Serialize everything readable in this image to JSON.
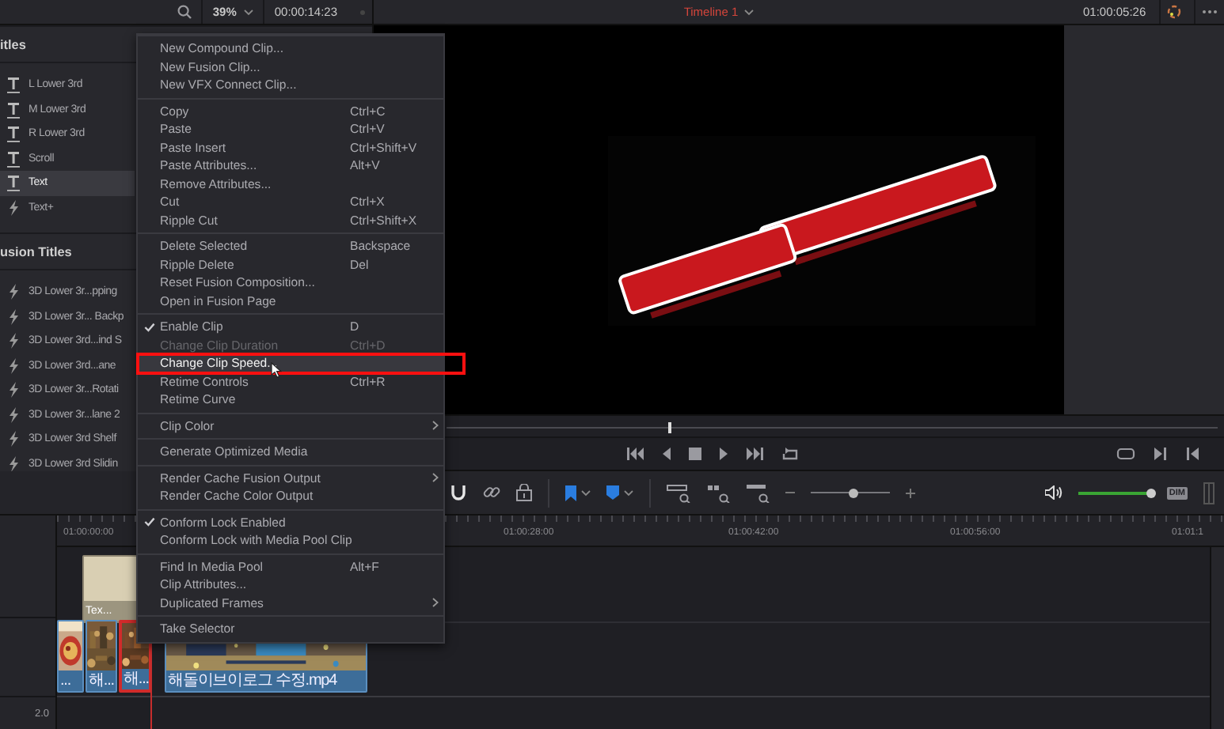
{
  "top_bar": {
    "zoom": "39%",
    "source_timecode": "00:00:14:23",
    "timeline_name": "Timeline 1",
    "record_timecode": "01:00:05:26"
  },
  "title_panel": {
    "sections": [
      {
        "heading": "itles",
        "items": [
          {
            "label": "L Lower 3rd",
            "kind": "text",
            "selected": false
          },
          {
            "label": "M Lower 3rd",
            "kind": "text",
            "selected": false
          },
          {
            "label": "R Lower 3rd",
            "kind": "text",
            "selected": false
          },
          {
            "label": "Scroll",
            "kind": "text",
            "selected": false
          },
          {
            "label": "Text",
            "kind": "text",
            "selected": true
          },
          {
            "label": "Text+",
            "kind": "fusion",
            "selected": false
          }
        ]
      },
      {
        "heading": "usion Titles",
        "items": [
          {
            "label": "3D Lower 3r...pping",
            "kind": "fusion",
            "selected": false
          },
          {
            "label": "3D Lower 3r... Backp",
            "kind": "fusion",
            "selected": false
          },
          {
            "label": "3D Lower 3rd...ind S",
            "kind": "fusion",
            "selected": false
          },
          {
            "label": "3D Lower 3rd...ane",
            "kind": "fusion",
            "selected": false
          },
          {
            "label": "3D Lower 3r...Rotati",
            "kind": "fusion",
            "selected": false
          },
          {
            "label": "3D Lower 3r...lane 2",
            "kind": "fusion",
            "selected": false
          },
          {
            "label": "3D Lower 3rd Shelf",
            "kind": "fusion",
            "selected": false
          },
          {
            "label": "3D Lower 3rd Slidin",
            "kind": "fusion",
            "selected": false
          }
        ]
      }
    ]
  },
  "scrubber": {
    "level": 0.29
  },
  "toolbar": {
    "zoom_slider": {
      "level": 0.53
    },
    "volume_slider": {
      "level": 1
    },
    "dim_button": "DIM"
  },
  "timeline": {
    "ruler": [
      "01:00:00:00",
      "01:00:28:00",
      "01:00:42:00",
      "01:00:56:00",
      "01:01:1"
    ],
    "audio_track_label": "2.0",
    "clips": [
      {
        "label": "Tex...",
        "kind": "title",
        "selected": false
      },
      {
        "label": "...",
        "kind": "video",
        "selected": false
      },
      {
        "label": "해...",
        "kind": "video",
        "selected": false
      },
      {
        "label": "해...",
        "kind": "video",
        "selected": true
      },
      {
        "label": "해돌이브이로그 수정.mp4",
        "kind": "video",
        "selected": false
      }
    ]
  },
  "context_menu": {
    "groups": [
      [
        {
          "label": "New Compound Clip...",
          "checked": false,
          "submenu": false,
          "disabled": false,
          "selected": false
        },
        {
          "label": "New Fusion Clip...",
          "checked": false,
          "submenu": false,
          "disabled": false,
          "selected": false
        },
        {
          "label": "New VFX Connect Clip...",
          "checked": false,
          "submenu": false,
          "disabled": false,
          "selected": false
        }
      ],
      [
        {
          "label": "Copy",
          "shortcut": "Ctrl+C",
          "checked": false,
          "submenu": false,
          "disabled": false,
          "selected": false
        },
        {
          "label": "Paste",
          "shortcut": "Ctrl+V",
          "checked": false,
          "submenu": false,
          "disabled": false,
          "selected": false
        },
        {
          "label": "Paste Insert",
          "shortcut": "Ctrl+Shift+V",
          "checked": false,
          "submenu": false,
          "disabled": false,
          "selected": false
        },
        {
          "label": "Paste Attributes...",
          "shortcut": "Alt+V",
          "checked": false,
          "submenu": false,
          "disabled": false,
          "selected": false
        },
        {
          "label": "Remove Attributes...",
          "checked": false,
          "submenu": false,
          "disabled": false,
          "selected": false
        },
        {
          "label": "Cut",
          "shortcut": "Ctrl+X",
          "checked": false,
          "submenu": false,
          "disabled": false,
          "selected": false
        },
        {
          "label": "Ripple Cut",
          "shortcut": "Ctrl+Shift+X",
          "checked": false,
          "submenu": false,
          "disabled": false,
          "selected": false
        }
      ],
      [
        {
          "label": "Delete Selected",
          "shortcut": "Backspace",
          "checked": false,
          "submenu": false,
          "disabled": false,
          "selected": false
        },
        {
          "label": "Ripple Delete",
          "shortcut": "Del",
          "checked": false,
          "submenu": false,
          "disabled": false,
          "selected": false
        },
        {
          "label": "Reset Fusion Composition...",
          "checked": false,
          "submenu": false,
          "disabled": false,
          "selected": false
        },
        {
          "label": "Open in Fusion Page",
          "checked": false,
          "submenu": false,
          "disabled": false,
          "selected": false
        }
      ],
      [
        {
          "label": "Enable Clip",
          "shortcut": "D",
          "checked": true,
          "submenu": false,
          "disabled": false,
          "selected": false
        },
        {
          "label": "Change Clip Duration",
          "shortcut": "Ctrl+D",
          "checked": false,
          "submenu": false,
          "disabled": true,
          "selected": false
        },
        {
          "label": "Change Clip Speed...",
          "checked": false,
          "submenu": false,
          "disabled": false,
          "selected": true
        },
        {
          "label": "Retime Controls",
          "shortcut": "Ctrl+R",
          "checked": false,
          "submenu": false,
          "disabled": false,
          "selected": false
        },
        {
          "label": "Retime Curve",
          "checked": false,
          "submenu": false,
          "disabled": false,
          "selected": false
        }
      ],
      [
        {
          "label": "Clip Color",
          "checked": false,
          "submenu": true,
          "disabled": false,
          "selected": false
        }
      ],
      [
        {
          "label": "Generate Optimized Media",
          "checked": false,
          "submenu": false,
          "disabled": false,
          "selected": false
        }
      ],
      [
        {
          "label": "Render Cache Fusion Output",
          "checked": false,
          "submenu": true,
          "disabled": false,
          "selected": false
        },
        {
          "label": "Render Cache Color Output",
          "checked": false,
          "submenu": false,
          "disabled": false,
          "selected": false
        }
      ],
      [
        {
          "label": "Conform Lock Enabled",
          "checked": true,
          "submenu": false,
          "disabled": false,
          "selected": false
        },
        {
          "label": "Conform Lock with Media Pool Clip",
          "checked": false,
          "submenu": false,
          "disabled": false,
          "selected": false
        }
      ],
      [
        {
          "label": "Find In Media Pool",
          "shortcut": "Alt+F",
          "checked": false,
          "submenu": false,
          "disabled": false,
          "selected": false
        },
        {
          "label": "Clip Attributes...",
          "checked": false,
          "submenu": false,
          "disabled": false,
          "selected": false
        },
        {
          "label": "Duplicated Frames",
          "checked": false,
          "submenu": true,
          "disabled": false,
          "selected": false
        }
      ],
      [
        {
          "label": "Take Selector",
          "checked": false,
          "submenu": false,
          "disabled": false,
          "selected": false
        }
      ]
    ]
  }
}
